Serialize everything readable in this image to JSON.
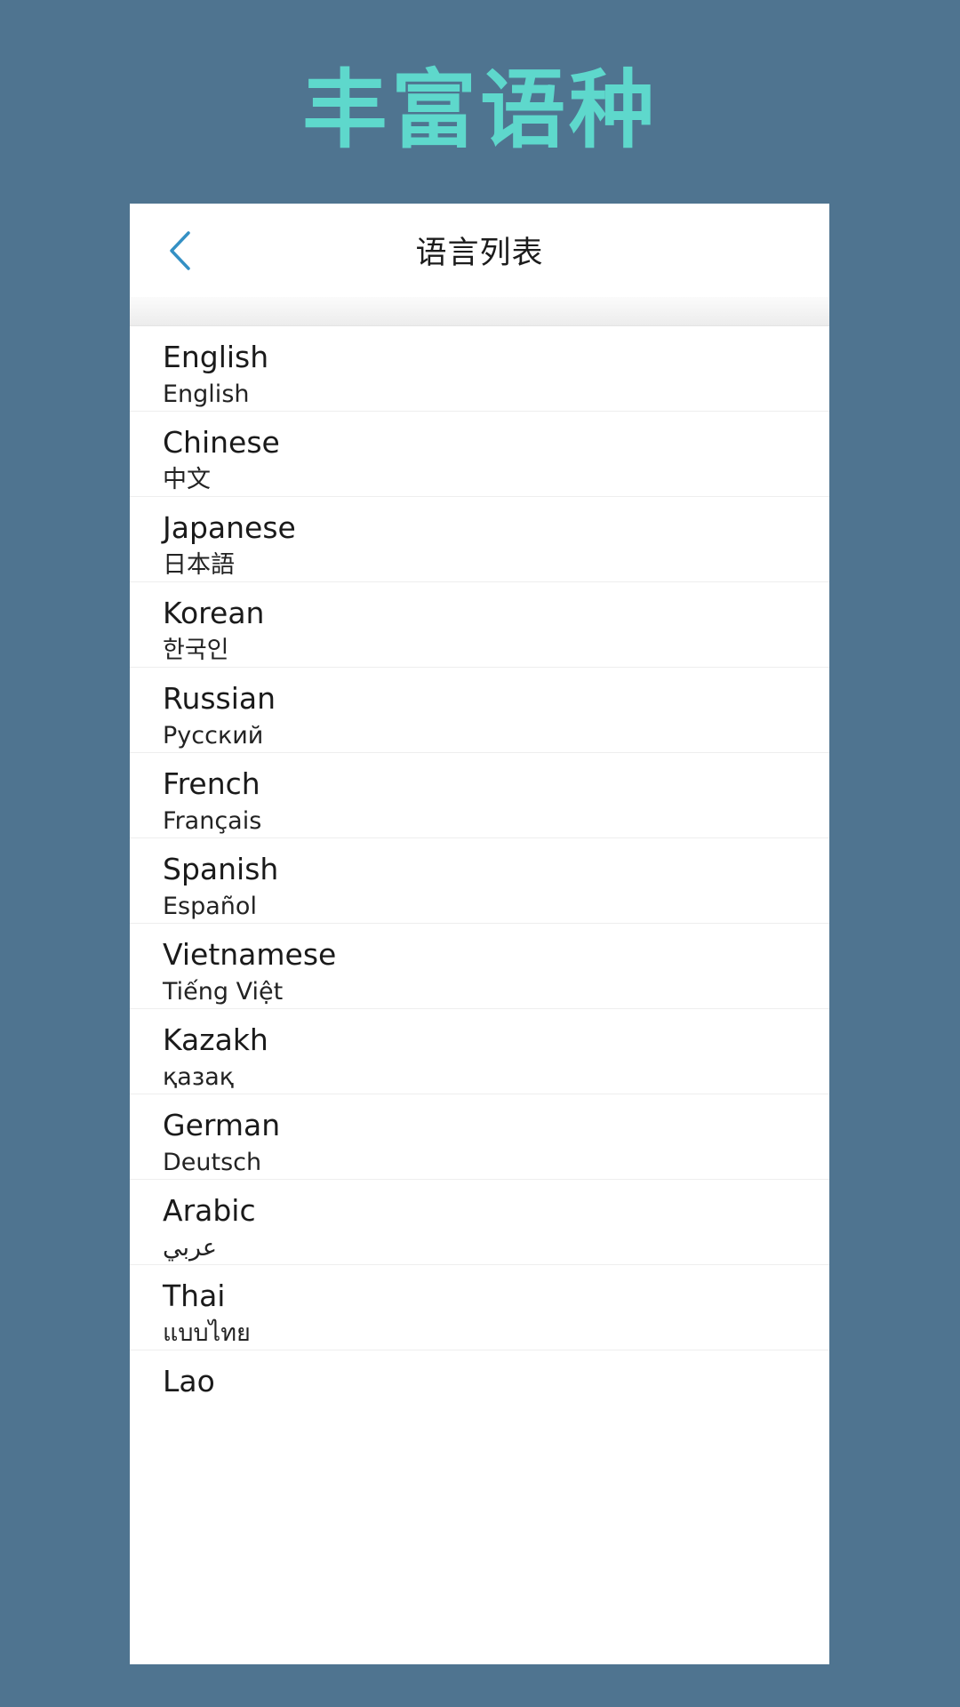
{
  "hero": {
    "title": "丰富语种",
    "title_color": "#5ed8cc",
    "background_color": "#4f7490"
  },
  "screen": {
    "navbar": {
      "back_icon": "chevron-left-icon",
      "back_icon_color": "#3490c4",
      "title": "语言列表"
    },
    "language_list": [
      {
        "name": "English",
        "native": "English"
      },
      {
        "name": "Chinese",
        "native": "中文"
      },
      {
        "name": "Japanese",
        "native": "日本語"
      },
      {
        "name": "Korean",
        "native": "한국인"
      },
      {
        "name": "Russian",
        "native": "Русский"
      },
      {
        "name": "French",
        "native": "Français"
      },
      {
        "name": "Spanish",
        "native": "Español"
      },
      {
        "name": "Vietnamese",
        "native": "Tiếng Việt"
      },
      {
        "name": "Kazakh",
        "native": "қазақ"
      },
      {
        "name": "German",
        "native": "Deutsch"
      },
      {
        "name": "Arabic",
        "native": "عربي"
      },
      {
        "name": "Thai",
        "native": "แบบไทย"
      },
      {
        "name": "Lao",
        "native": ""
      }
    ]
  }
}
